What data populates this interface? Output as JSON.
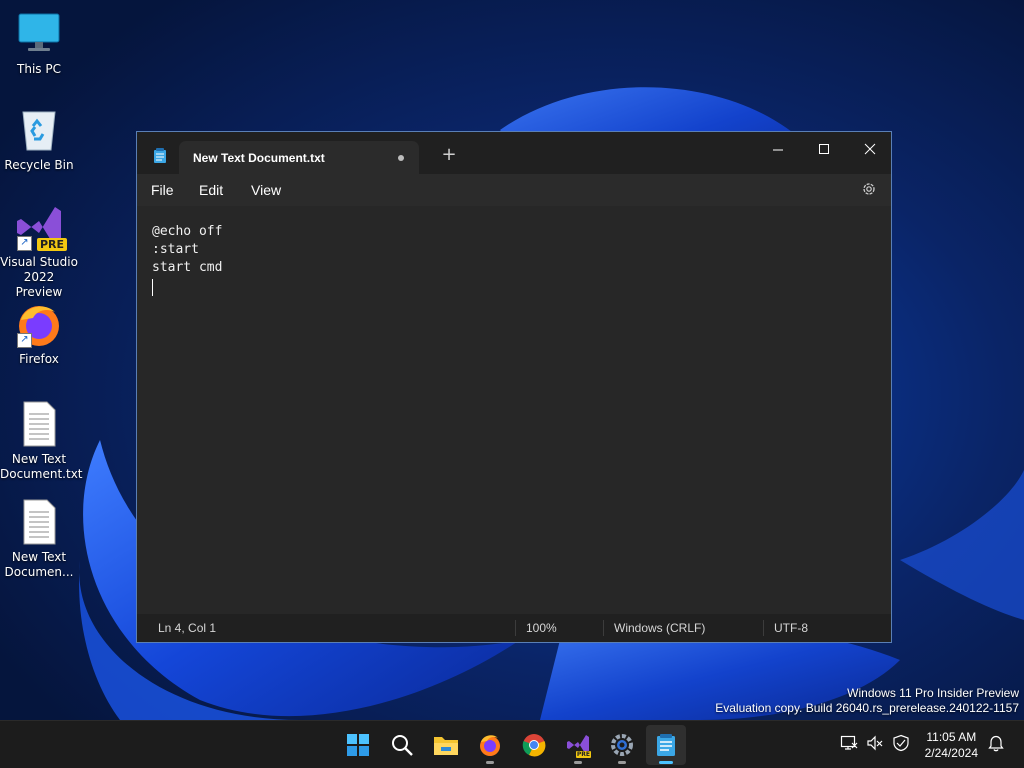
{
  "desktop": {
    "icons": [
      {
        "label": "This PC"
      },
      {
        "label": "Recycle Bin"
      },
      {
        "label": "Visual Studio 2022 Preview",
        "badge": "PRE"
      },
      {
        "label": "Firefox"
      },
      {
        "label": "New Text Document.txt"
      },
      {
        "label": "New Text Documen..."
      }
    ]
  },
  "notepad": {
    "tab_title": "New Text Document.txt",
    "new_tab": "+",
    "menu": {
      "file": "File",
      "edit": "Edit",
      "view": "View"
    },
    "lines": [
      "@echo off",
      ":start",
      "start cmd",
      ""
    ],
    "status": {
      "position": "Ln 4, Col 1",
      "zoom": "100%",
      "line_ending": "Windows (CRLF)",
      "encoding": "UTF-8"
    }
  },
  "watermark": {
    "line1": "Windows 11 Pro Insider Preview",
    "line2": "Evaluation copy. Build 26040.rs_prerelease.240122-1157"
  },
  "taskbar": {
    "apps": [
      "start-icon",
      "search-icon",
      "file-explorer-icon",
      "firefox-icon",
      "chrome-icon",
      "visual-studio-icon",
      "settings-icon",
      "notepad-icon"
    ],
    "vs_badge": "PRE",
    "time": "11:05 AM",
    "date": "2/24/2024"
  },
  "colors": {
    "accent": "#4cc2ff",
    "window_bg": "#272727",
    "taskbar_bg": "#1c1c1c"
  }
}
